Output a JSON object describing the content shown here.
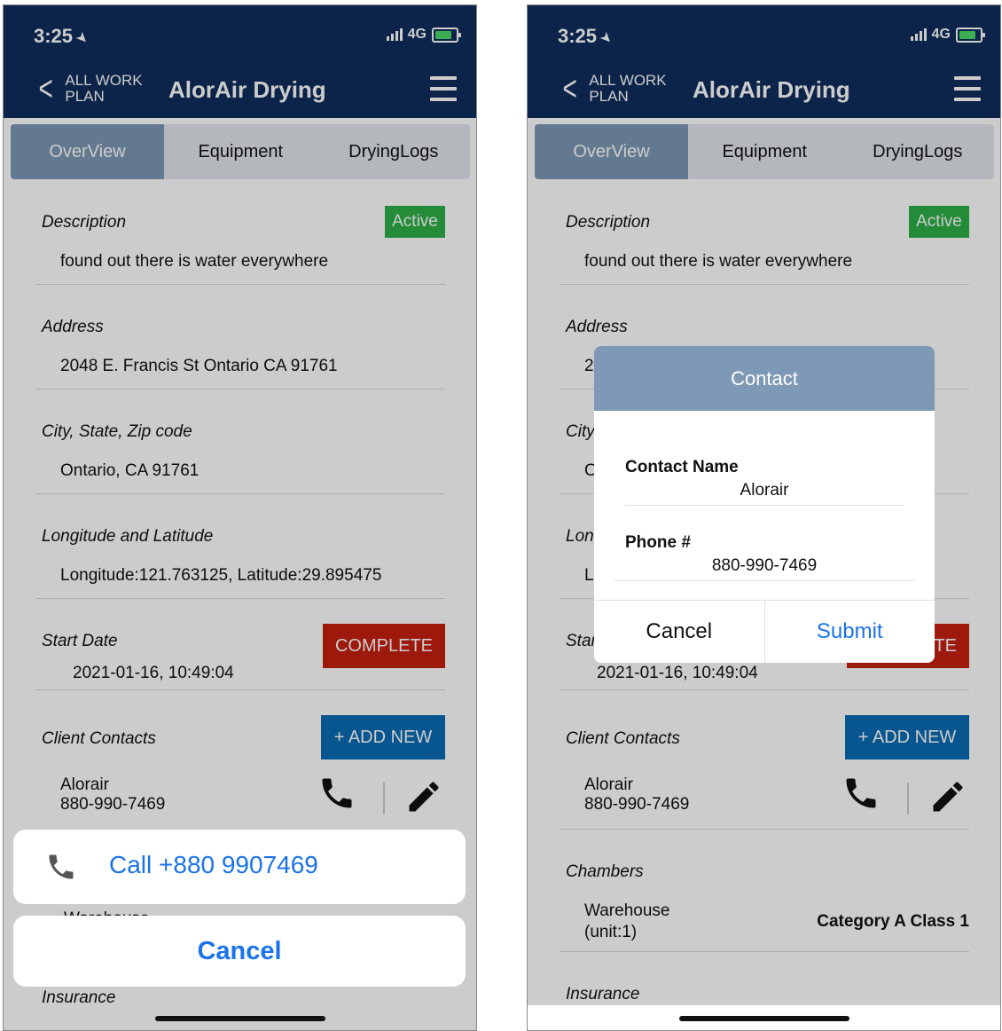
{
  "status": {
    "time": "3:25",
    "network": "4G"
  },
  "header": {
    "back_label": "ALL WORK PLAN",
    "title": "AlorAir Drying"
  },
  "tabs": [
    {
      "label": "OverView"
    },
    {
      "label": "Equipment"
    },
    {
      "label": "DryingLogs"
    }
  ],
  "overview": {
    "description_label": "Description",
    "description_value": "found out there is water everywhere",
    "status_badge": "Active",
    "address_label": "Address",
    "address_value": "2048 E. Francis St Ontario CA 91761",
    "city_label": "City, State, Zip code",
    "city_value": "Ontario, CA 91761",
    "longlat_label": "Longitude and Latitude",
    "longlat_value": "Longitude:121.763125, Latitude:29.895475",
    "start_label": "Start Date",
    "start_value": "2021-01-16, 10:49:04",
    "complete_button": "COMPLETE",
    "contacts_label": "Client Contacts",
    "add_new_button": "+ ADD NEW",
    "contact_name": "Alorair",
    "contact_phone": "880-990-7469",
    "chambers_label": "Chambers",
    "chamber_name": "Warehouse",
    "chamber_unit": "(unit:1)",
    "chamber_category": "Category A Class 1",
    "insurance_label": "Insurance"
  },
  "action_sheet": {
    "call_label": "Call +880 9907469",
    "cancel_label": "Cancel"
  },
  "contact_dialog": {
    "title": "Contact",
    "name_label": "Contact Name",
    "name_value": "Alorair",
    "phone_label": "Phone #",
    "phone_value": "880-990-7469",
    "cancel_label": "Cancel",
    "submit_label": "Submit"
  },
  "colors": {
    "header": "#0f2e5c",
    "tab_active": "#7c98b4",
    "active_badge": "#2db046",
    "complete_button": "#c5200f",
    "add_new_button": "#0a6cb3",
    "link_blue": "#1a73e8"
  }
}
